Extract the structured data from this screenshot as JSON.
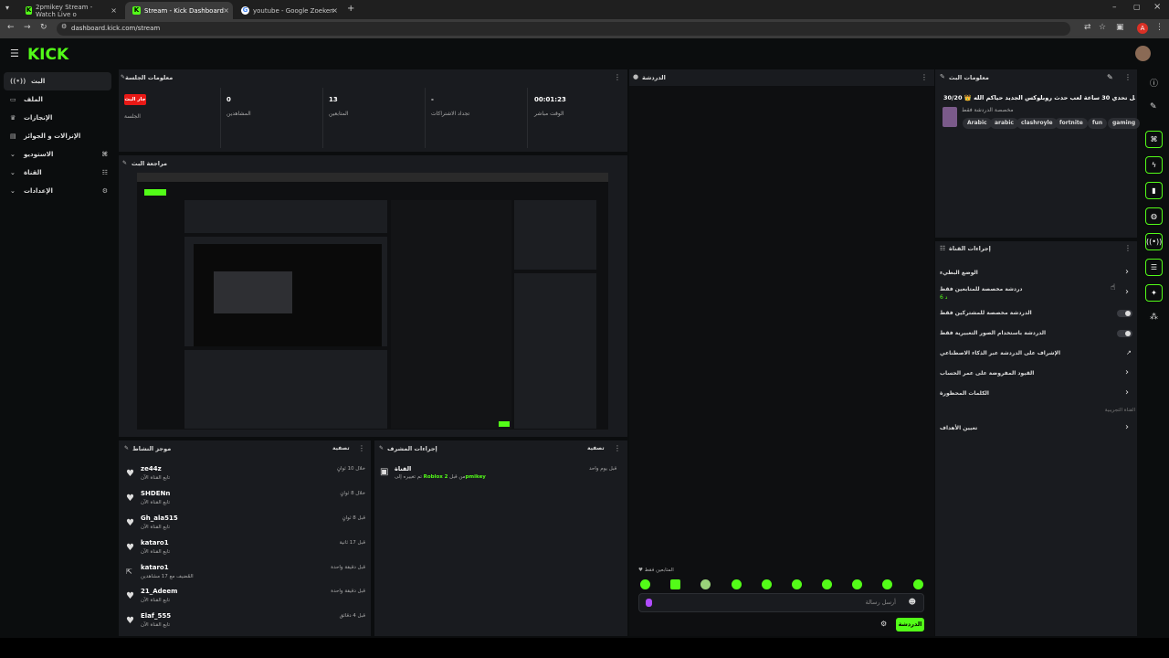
{
  "browser": {
    "tabs": [
      {
        "label": "2pmikey Stream - Watch Live o",
        "icon": "kick-icon"
      },
      {
        "label": "Stream - Kick Dashboard",
        "icon": "kick-icon"
      },
      {
        "label": "youtube - Google Zoeken",
        "icon": "google-icon"
      }
    ],
    "new_tab": "+",
    "url": "dashboard.kick.com/stream",
    "profile_initial": "A"
  },
  "header": {
    "logo": "KICK"
  },
  "sidebar": {
    "items": [
      {
        "label": "البث",
        "icon": "broadcast-icon"
      },
      {
        "label": "الملف",
        "icon": "file-icon"
      },
      {
        "label": "الإنجازات",
        "icon": "trophy-icon"
      },
      {
        "label": "الإنزالات و الجوائز",
        "icon": "gift-icon"
      },
      {
        "label": "الاستوديو",
        "icon": "chevron-down-icon"
      },
      {
        "label": "القناة",
        "icon": "chevron-down-icon"
      },
      {
        "label": "الإعدادات",
        "icon": "chevron-down-icon"
      }
    ]
  },
  "session": {
    "title": "معلومات الجلسة",
    "live_badge": "جار البث",
    "session_label": "الجلسة",
    "stats": [
      {
        "value": "0",
        "label": "المشاهدين"
      },
      {
        "value": "13",
        "label": "المتابعين"
      },
      {
        "value": "-",
        "label": "تجداد الاشتراكات"
      },
      {
        "value": "00:01:23",
        "label": "الوقت مباشر"
      }
    ]
  },
  "preview": {
    "title": "مراجعة البث"
  },
  "activity": {
    "title": "موجز النشاط",
    "filter": "تصفية",
    "rows": [
      {
        "name": "ze44z",
        "desc": "تابع القناة الآن",
        "time": "خلال 10 ثوانٍ"
      },
      {
        "name": "SHDENn",
        "desc": "تابع القناة الآن",
        "time": "خلال 8 ثوانٍ"
      },
      {
        "name": "Gh_ala515",
        "desc": "تابع القناة الآن",
        "time": "قبل 8 ثوانٍ"
      },
      {
        "name": "kataro1",
        "desc": "تابع القناة الآن",
        "time": "قبل 17 ثانية"
      },
      {
        "name": "kataro1",
        "desc": "المُضيف مع 17 مشاهدين",
        "time": "قبل دقيقة واحدة"
      },
      {
        "name": "21_Adeem",
        "desc": "تابع القناة الآن",
        "time": "قبل دقيقة واحدة"
      },
      {
        "name": "Elaf_555",
        "desc": "تابع القناة الآن",
        "time": "قبل 4 دقائق"
      }
    ]
  },
  "mod_actions": {
    "title": "إجراءات المشرف",
    "filter": "تصفية",
    "entry_title": "القناة",
    "entry_pre": "من قبل",
    "entry_user": "2pmikey",
    "entry_category": "Roblox",
    "entry_post": "تم تغييره إلى",
    "entry_time": "قبل يوم واحد"
  },
  "chat": {
    "title": "الدردشة",
    "followers_only": "المتابعين فقط",
    "placeholder": "أرسل رسالة",
    "send": "الدردشة"
  },
  "stream_info": {
    "title": "معلومات البث",
    "stream_title": "ساعتين أكمل تحدي 30 ساعة لعب حدث روبلوكس الجديد حياكم الله 👑 30/20",
    "category_line": "مخصصة الدردشة فقط",
    "tags": [
      "gaming",
      "fun",
      "fortnite",
      "clashroyle",
      "arabic",
      "Arabic"
    ]
  },
  "channel_actions": {
    "title": "إجراءات القناة",
    "items": [
      {
        "label": "الوضع البطيء",
        "sub": "",
        "control": "chevron"
      },
      {
        "label": "دردشة مخصصة للمتابعين فقط",
        "sub": "6 د",
        "control": "chevron"
      },
      {
        "label": "الدردشة مخصصة للمشتركين فقط",
        "sub": "",
        "control": "toggle"
      },
      {
        "label": "الدردشة باستخدام الصور التعبيرية فقط",
        "sub": "",
        "control": "toggle"
      },
      {
        "label": "الإشراف على الدردشة عبر الذكاء الاصطناعي",
        "sub": "",
        "control": "external"
      },
      {
        "label": "القيود المفروضة على عمر الحساب",
        "sub": "",
        "control": "chevron"
      },
      {
        "label": "الكلمات المحظورة",
        "sub": "",
        "control": "chevron"
      }
    ],
    "section_label": "القناة التجريبية",
    "goals_label": "تعيين الأهداف"
  }
}
